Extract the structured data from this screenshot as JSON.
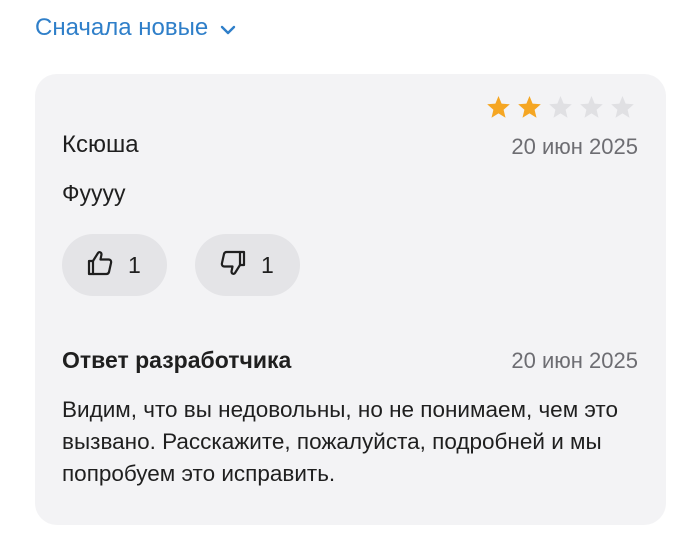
{
  "sort": {
    "label": "Сначала новые",
    "icon": "chevron-down-icon"
  },
  "review": {
    "rating": 2,
    "max_rating": 5,
    "star_filled_color": "#f5a623",
    "star_empty_color": "#e0e0e3",
    "author": "Ксюша",
    "date": "20 июн 2025",
    "text": "Фуууу",
    "likes": "1",
    "dislikes": "1"
  },
  "reply": {
    "title": "Ответ разработчика",
    "date": "20 июн 2025",
    "text": "Видим, что вы недовольны, но не понимаем, чем это вызвано. Расскажите, пожалуйста, подробней и мы попробуем это исправить."
  },
  "colors": {
    "accent": "#2f7fc9",
    "card_bg": "#f3f3f5",
    "button_bg": "#e4e4e7"
  }
}
